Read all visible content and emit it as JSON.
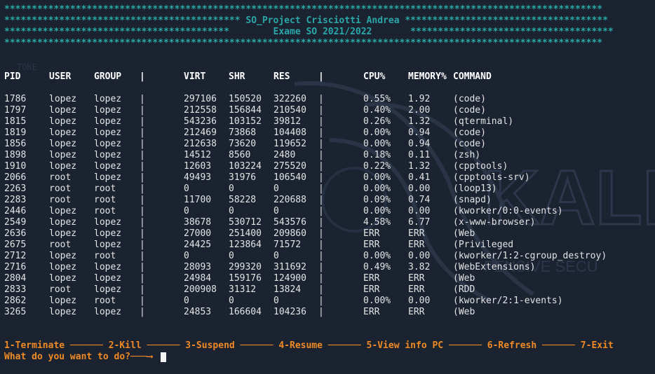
{
  "banner": {
    "line1": "*************************************************************************************************************",
    "line2": "******************************************* SO_Project Crisciotti Andrea *************************************",
    "line3": "*****************************************        Exame SO 2021/2022       *************************************",
    "line4": "*************************************************************************************************************"
  },
  "table": {
    "headers": [
      "PID",
      "USER",
      "GROUP",
      "|",
      "VIRT",
      "SHR",
      "RES",
      "|",
      "CPU%",
      "MEMORY%",
      "COMMAND"
    ],
    "rows": [
      [
        "1786",
        "lopez",
        "lopez",
        "|",
        "297106",
        "150520",
        "322260",
        "|",
        "0.55%",
        "1.92",
        "(code)"
      ],
      [
        "1797",
        "lopez",
        "lopez",
        "|",
        "212558",
        "156844",
        "210540",
        "|",
        "0.40%",
        "2.00",
        "(code)"
      ],
      [
        "1815",
        "lopez",
        "lopez",
        "|",
        "543236",
        "103152",
        "39812",
        "|",
        "0.26%",
        "1.32",
        "(qterminal)"
      ],
      [
        "1819",
        "lopez",
        "lopez",
        "|",
        "212469",
        "73868",
        "104408",
        "|",
        "0.00%",
        "0.94",
        "(code)"
      ],
      [
        "1856",
        "lopez",
        "lopez",
        "|",
        "212638",
        "73620",
        "119652",
        "|",
        "0.00%",
        "0.94",
        "(code)"
      ],
      [
        "1898",
        "lopez",
        "lopez",
        "|",
        "14512",
        "8560",
        "2480",
        "|",
        "0.18%",
        "0.11",
        "(zsh)"
      ],
      [
        "1910",
        "lopez",
        "lopez",
        "|",
        "12603",
        "103224",
        "275520",
        "|",
        "0.22%",
        "1.32",
        "(cpptools)"
      ],
      [
        "2066",
        "root",
        "lopez",
        "|",
        "49493",
        "31976",
        "106540",
        "|",
        "0.00%",
        "0.41",
        "(cpptools-srv)"
      ],
      [
        "2263",
        "root",
        "root",
        "|",
        "0",
        "0",
        "0",
        "|",
        "0.00%",
        "0.00",
        "(loop13)"
      ],
      [
        "2283",
        "root",
        "root",
        "|",
        "11700",
        "58228",
        "220688",
        "|",
        "0.09%",
        "0.74",
        "(snapd)"
      ],
      [
        "2446",
        "lopez",
        "root",
        "|",
        "0",
        "0",
        "0",
        "|",
        "0.00%",
        "0.00",
        "(kworker/0:0-events)"
      ],
      [
        "2549",
        "lopez",
        "lopez",
        "|",
        "38678",
        "530712",
        "543576",
        "|",
        "4.58%",
        "6.77",
        "(x-www-browser)"
      ],
      [
        "2636",
        "lopez",
        "lopez",
        "|",
        "27000",
        "251400",
        "209860",
        "|",
        "ERR",
        "ERR",
        "(Web"
      ],
      [
        "2675",
        "root",
        "lopez",
        "|",
        "24425",
        "123864",
        "71572",
        "|",
        "ERR",
        "ERR",
        "(Privileged"
      ],
      [
        "2712",
        "lopez",
        "root",
        "|",
        "0",
        "0",
        "0",
        "|",
        "0.00%",
        "0.00",
        "(kworker/1:2-cgroup_destroy)"
      ],
      [
        "2716",
        "lopez",
        "lopez",
        "|",
        "28093",
        "299320",
        "311692",
        "|",
        "0.49%",
        "3.82",
        "(WebExtensions)"
      ],
      [
        "2804",
        "lopez",
        "lopez",
        "|",
        "24984",
        "159176",
        "124900",
        "|",
        "ERR",
        "ERR",
        "(Web"
      ],
      [
        "2833",
        "root",
        "lopez",
        "|",
        "200908",
        "31312",
        "13824",
        "|",
        "ERR",
        "ERR",
        "(RDD"
      ],
      [
        "2862",
        "lopez",
        "root",
        "|",
        "0",
        "0",
        "0",
        "|",
        "0.00%",
        "0.00",
        "(kworker/2:1-events)"
      ],
      [
        "3265",
        "lopez",
        "lopez",
        "|",
        "24853",
        "166604",
        "104236",
        "|",
        "ERR",
        "ERR",
        "(Web"
      ]
    ]
  },
  "menu": {
    "options": "1-Terminate ────── 2-Kill ────── 3-Suspend ────── 4-Resume ────── 5-View info PC ────── 6-Refresh ────── 7-Exit",
    "prompt": "What do you want to do?───⟶"
  },
  "background": {
    "logo_text": "KALI",
    "tagline": "PENSIVE SECU",
    "faint_label": "TOKE"
  },
  "colors": {
    "background": "#1b2230",
    "banner": "#2aa7a9",
    "menu": "#f08a24",
    "text": "#e4e4e4"
  }
}
